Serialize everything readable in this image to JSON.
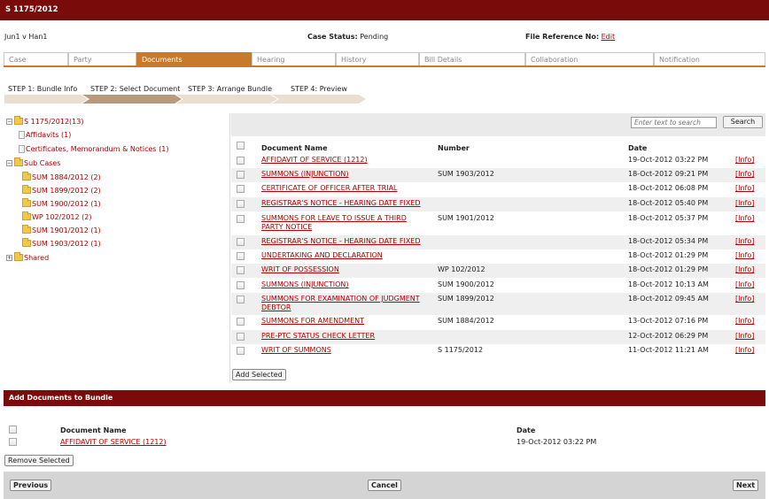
{
  "title": "S 1175/2012",
  "info": {
    "parties": "Jun1 v Han1",
    "case_status_label": "Case Status:",
    "case_status_value": "Pending",
    "file_ref_label": "File Reference No:",
    "file_ref_link": "Edit"
  },
  "tabs": [
    "Case",
    "Party",
    "Documents",
    "Hearing",
    "History",
    "Bill Details",
    "Collaboration",
    "Notification"
  ],
  "active_tab": "Documents",
  "steps": [
    "STEP 1: Bundle Info",
    "STEP 2: Select Document",
    "STEP 3: Arrange Bundle",
    "STEP 4: Preview"
  ],
  "tree": {
    "root": "S 1175/2012(13)",
    "affidavits": "Affidavits (1)",
    "certificates": "Certificates, Memorandum & Notices (1)",
    "sub_cases": "Sub Cases",
    "sub_items": [
      "SUM 1884/2012 (2)",
      "SUM 1899/2012 (2)",
      "SUM 1900/2012 (1)",
      "WP 102/2012 (2)",
      "SUM 1901/2012 (1)",
      "SUM 1903/2012 (1)"
    ],
    "shared": "Shared"
  },
  "search": {
    "placeholder": "Enter text to search",
    "button": "Search"
  },
  "table": {
    "headers": {
      "name": "Document Name",
      "number": "Number",
      "date": "Date"
    },
    "info_label": "[Info]",
    "rows": [
      {
        "name": "AFFIDAVIT OF SERVICE (1212)",
        "number": "",
        "date": "19-Oct-2012 03:22 PM"
      },
      {
        "name": "SUMMONS (INJUNCTION)",
        "number": "SUM 1903/2012",
        "date": "18-Oct-2012 09:21 PM"
      },
      {
        "name": "CERTIFICATE OF OFFICER AFTER TRIAL",
        "number": "",
        "date": "18-Oct-2012 06:08 PM"
      },
      {
        "name": "REGISTRAR'S NOTICE - HEARING DATE FIXED",
        "number": "",
        "date": "18-Oct-2012 05:40 PM"
      },
      {
        "name": "SUMMONS FOR LEAVE TO ISSUE A THIRD",
        "name2": "PARTY NOTICE",
        "number": "SUM 1901/2012",
        "date": "18-Oct-2012 05:37 PM"
      },
      {
        "name": "REGISTRAR'S NOTICE - HEARING DATE FIXED",
        "number": "",
        "date": "18-Oct-2012 05:34 PM"
      },
      {
        "name": "UNDERTAKING AND DECLARATION",
        "number": "",
        "date": "18-Oct-2012 01:29 PM"
      },
      {
        "name": "WRIT OF POSSESSION",
        "number": "WP 102/2012",
        "date": "18-Oct-2012 01:29 PM"
      },
      {
        "name": "SUMMONS (INJUNCTION)",
        "number": "SUM 1900/2012",
        "date": "18-Oct-2012 10:13 AM"
      },
      {
        "name": "SUMMONS FOR EXAMINATION OF JUDGMENT",
        "name2": "DEBTOR",
        "number": "SUM 1899/2012",
        "date": "18-Oct-2012 09:45 AM"
      },
      {
        "name": "SUMMONS FOR AMENDMENT",
        "number": "SUM 1884/2012",
        "date": "13-Oct-2012 07:16 PM"
      },
      {
        "name": "PRE-PTC STATUS CHECK LETTER",
        "number": "",
        "date": "12-Oct-2012 06:29 PM"
      },
      {
        "name": "WRIT OF SUMMONS",
        "number": "S 1175/2012",
        "date": "11-Oct-2012 11:21 AM"
      }
    ],
    "add_selected": "Add Selected"
  },
  "bundle": {
    "header": "Add Documents to Bundle",
    "col_name": "Document Name",
    "col_date": "Date",
    "rows": [
      {
        "name": "AFFIDAVIT OF SERVICE (1212)",
        "date": "19-Oct-2012 03:22 PM"
      }
    ],
    "remove_selected": "Remove Selected"
  },
  "footer": {
    "previous": "Previous",
    "cancel": "Cancel",
    "next": "Next"
  }
}
